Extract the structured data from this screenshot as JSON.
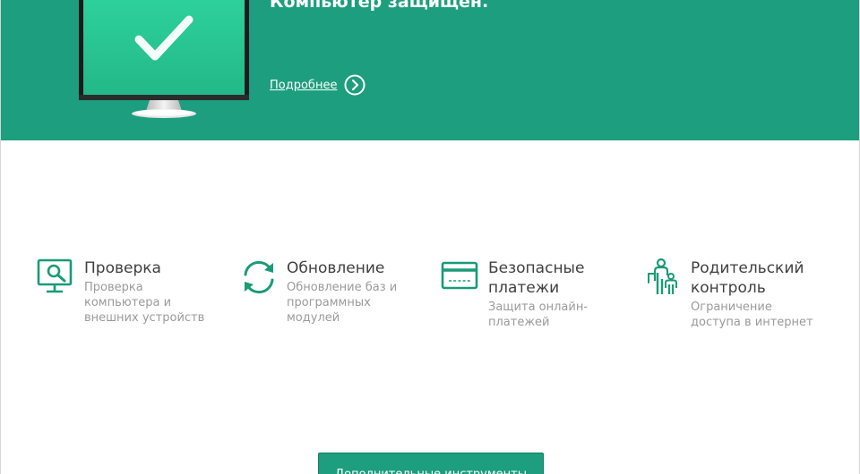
{
  "status": {
    "title": "Компьютер защищен.",
    "details_link": "Подробнее"
  },
  "features": [
    {
      "title": "Проверка",
      "description": "Проверка\nкомпьютера и\nвнешних устройств",
      "icon": "scan-monitor-icon"
    },
    {
      "title": "Обновление",
      "description": "Обновление баз и\nпрограммных\nмодулей",
      "icon": "update-arrows-icon"
    },
    {
      "title": "Безопасные\nплатежи",
      "description": "Защита онлайн-\nплатежей",
      "icon": "credit-card-icon"
    },
    {
      "title": "Родительский\nконтроль",
      "description": "Ограничение\nдоступа в интернет",
      "icon": "parental-family-icon"
    }
  ],
  "tools_button": "Дополнительные инструменты",
  "colors": {
    "accent": "#1d9e7e",
    "icon": "#1a9a78",
    "title_text": "#3f3f3f",
    "desc_text": "#9a9a9a"
  }
}
